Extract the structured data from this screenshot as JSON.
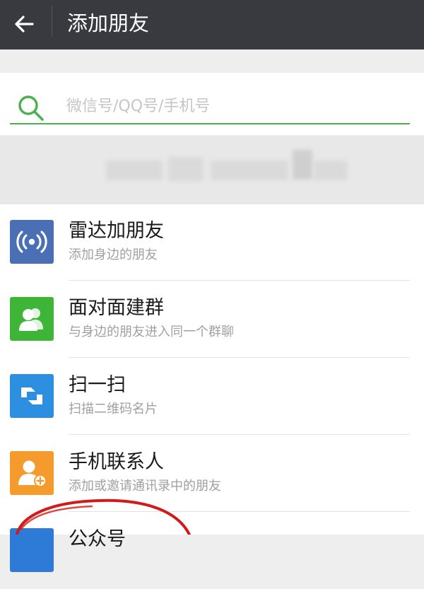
{
  "header": {
    "title": "添加朋友"
  },
  "search": {
    "placeholder": "微信号/QQ号/手机号",
    "accent": "#4bb04f"
  },
  "items": [
    {
      "name": "雷达加朋友",
      "desc": "添加身边的朋友",
      "icon": "radar-icon",
      "color": "#4a6fb5"
    },
    {
      "name": "面对面建群",
      "desc": "与身边的朋友进入同一个群聊",
      "icon": "face-to-face-group-icon",
      "color": "#3fb538"
    },
    {
      "name": "扫一扫",
      "desc": "扫描二维码名片",
      "icon": "scan-icon",
      "color": "#2d8fe0"
    },
    {
      "name": "手机联系人",
      "desc": "添加或邀请通讯录中的朋友",
      "icon": "phone-contacts-icon",
      "color": "#f59b2d"
    },
    {
      "name": "公众号",
      "desc": "",
      "icon": "official-account-icon",
      "color": "#2d7bd6"
    }
  ]
}
